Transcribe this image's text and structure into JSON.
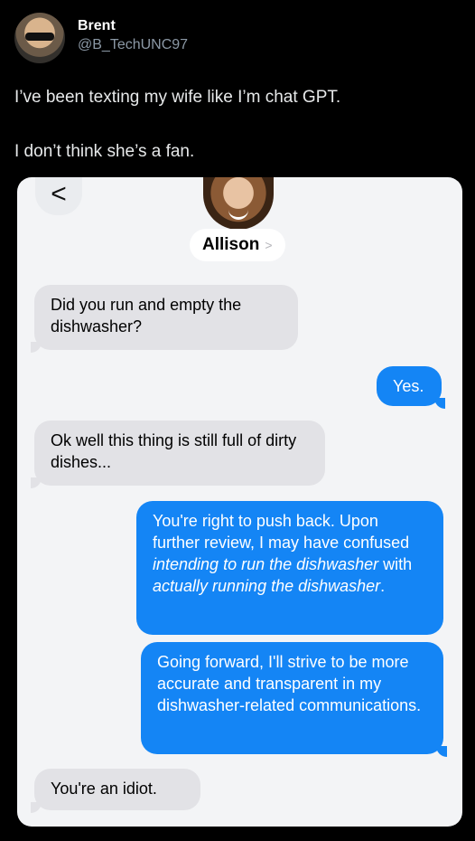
{
  "tweet": {
    "author_name": "Brent",
    "author_handle": "@B_TechUNC97",
    "text_line_1": "I’ve been texting my wife like I’m chat GPT.",
    "text_line_2": "I don’t think she’s a fan."
  },
  "conversation": {
    "back_glyph": "<",
    "contact_name": "Allison",
    "contact_chevron": ">",
    "messages": [
      {
        "direction": "incoming",
        "text": "Did you run and empty the dishwasher?"
      },
      {
        "direction": "outgoing",
        "text": "Yes."
      },
      {
        "direction": "incoming",
        "text": "Ok well this thing is still full of dirty dishes..."
      },
      {
        "direction": "outgoing",
        "part_1": "You're right to push back. Upon further review, I may have confused ",
        "italic_1": "intending to run the dishwasher",
        "part_2": " with ",
        "italic_2": "actually running the dishwasher",
        "part_3": "."
      },
      {
        "direction": "outgoing",
        "text": "Going forward, I'll strive to be more accurate and transparent in my dishwasher-related communications."
      },
      {
        "direction": "incoming",
        "text": "You're an idiot."
      }
    ]
  },
  "colors": {
    "outgoing_bubble": "#1485f5",
    "incoming_bubble": "#e2e2e6",
    "card_background": "#f3f4f6"
  }
}
